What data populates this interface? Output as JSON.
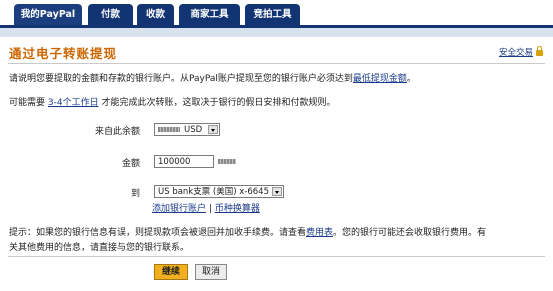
{
  "tabs": [
    {
      "label": "我的PayPal"
    },
    {
      "label": "付款"
    },
    {
      "label": "收款"
    },
    {
      "label": "商家工具"
    },
    {
      "label": "竞拍工具"
    }
  ],
  "page": {
    "title": "通过电子转账提现",
    "security_link": "安全交易"
  },
  "intro": {
    "line1_text": "请说明您要提取的金额和存款的银行账户。从PayPal账户提现至您的银行账户必须达到",
    "line1_link": "最低提现金额",
    "line1_end": "。",
    "line2_text": "可能需要 ",
    "line2_link": "3-4个工作日",
    "line2_end": " 才能完成此次转账，这取决于银行的假日安排和付款规则。"
  },
  "form": {
    "from_label": "来自此余额",
    "from_value": "USD",
    "amount_label": "金额",
    "amount_value": "100000",
    "to_label": "到",
    "to_value": "US bank支票 (美国) x-6645",
    "add_bank_link": "添加银行账户",
    "separator": "|",
    "currency_converter_link": "币种换算器"
  },
  "tip": {
    "text1": "提示：如果您的银行信息有误，则提现款项会被退回并加收手续费。请查看",
    "link": "费用表",
    "text2": "。您的银行可能还会收取银行费用。有",
    "line2": "关其他费用的信息，请直接与您的银行联系。"
  },
  "buttons": {
    "continue": "继续",
    "cancel": "取消"
  },
  "colors": {
    "tab_bg": "#123472",
    "title": "#cc6600",
    "link": "#1a3b8a",
    "primary_button": "#f2b01e"
  }
}
